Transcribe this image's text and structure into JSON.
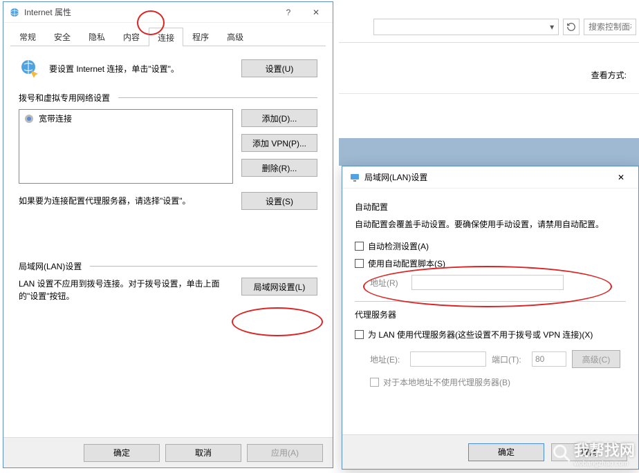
{
  "bg": {
    "combo_placeholder": "",
    "search_placeholder": "搜索控制面板",
    "view_label": "查看方式:"
  },
  "dlg1": {
    "title": "Internet 属性",
    "tabs": [
      "常规",
      "安全",
      "隐私",
      "内容",
      "连接",
      "程序",
      "高级"
    ],
    "active_tab": 4,
    "row_set_text": "要设置 Internet 连接，单击\"设置\"。",
    "btn_setup": "设置(U)",
    "sec_dial": "拨号和虚拟专用网络设置",
    "list_item": "宽带连接",
    "btn_add": "添加(D)...",
    "btn_add_vpn": "添加 VPN(P)...",
    "btn_remove": "删除(R)...",
    "btn_settings": "设置(S)",
    "note_text": "如果要为连接配置代理服务器，请选择\"设置\"。",
    "sec_lan": "局域网(LAN)设置",
    "lan_text": "LAN 设置不应用到拨号连接。对于拨号设置，单击上面的\"设置\"按钮。",
    "btn_lan": "局域网设置(L)",
    "btn_ok": "确定",
    "btn_cancel": "取消",
    "btn_apply": "应用(A)"
  },
  "dlg2": {
    "title": "局域网(LAN)设置",
    "grp_auto": "自动配置",
    "auto_note": "自动配置会覆盖手动设置。要确保使用手动设置，请禁用自动配置。",
    "chk_autodetect": "自动检测设置(A)",
    "chk_script": "使用自动配置脚本(S)",
    "addr_r_label": "地址(R)",
    "grp_proxy": "代理服务器",
    "chk_proxy": "为 LAN 使用代理服务器(这些设置不用于拨号或 VPN 连接)(X)",
    "addr_e_label": "地址(E):",
    "port_label": "端口(T):",
    "port_value": "80",
    "btn_advanced": "高级(C)",
    "chk_bypass": "对于本地地址不使用代理服务器(B)",
    "btn_ok": "确定",
    "btn_cancel": "取消"
  },
  "watermark": {
    "big": "我帮找网",
    "small": "wobangzhao.com"
  }
}
